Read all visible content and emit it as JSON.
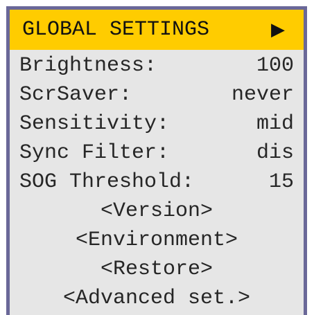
{
  "menu": {
    "title": "GLOBAL SETTINGS",
    "arrow_icon": "right-triangle-icon",
    "colors": {
      "header_bg": "#ffcc00",
      "panel_bg": "#e6e6e6",
      "border": "#6a6898",
      "text": "#262626"
    },
    "settings": [
      {
        "label": "Brightness:",
        "value": "100"
      },
      {
        "label": "ScrSaver:",
        "value": "never"
      },
      {
        "label": "Sensitivity:",
        "value": "mid"
      },
      {
        "label": "Sync Filter:",
        "value": "dis"
      },
      {
        "label": "SOG Threshold:",
        "value": "15"
      }
    ],
    "actions": [
      {
        "label": "<Version>"
      },
      {
        "label": "<Environment>"
      },
      {
        "label": "<Restore>"
      },
      {
        "label": "<Advanced set.>"
      }
    ]
  }
}
